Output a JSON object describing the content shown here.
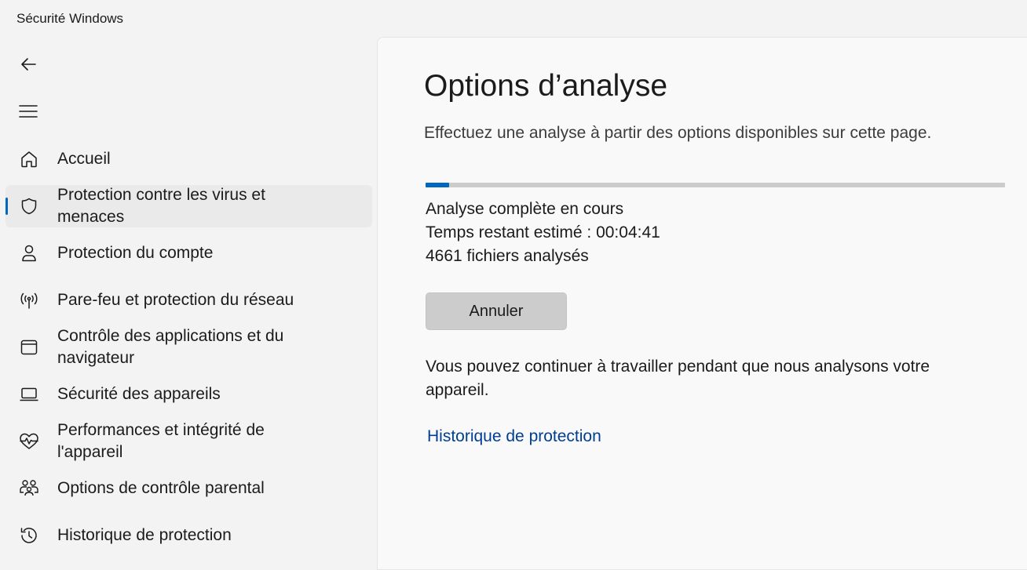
{
  "window": {
    "title": "Sécurité Windows"
  },
  "nav": {
    "back_icon": "back-arrow-icon",
    "menu_icon": "hamburger-menu-icon",
    "items": [
      {
        "label": "Accueil",
        "icon": "home-icon",
        "active": false
      },
      {
        "label": "Protection contre les virus et menaces",
        "icon": "shield-icon",
        "active": true
      },
      {
        "label": "Protection du compte",
        "icon": "person-icon",
        "active": false
      },
      {
        "label": "Pare-feu et protection du réseau",
        "icon": "wireless-antenna-icon",
        "active": false
      },
      {
        "label": "Contrôle des applications et du navigateur",
        "icon": "app-window-icon",
        "active": false
      },
      {
        "label": "Sécurité des appareils",
        "icon": "laptop-icon",
        "active": false
      },
      {
        "label": "Performances et intégrité de l'appareil",
        "icon": "heart-pulse-icon",
        "active": false
      },
      {
        "label": "Options de contrôle parental",
        "icon": "family-icon",
        "active": false
      },
      {
        "label": "Historique de protection",
        "icon": "history-icon",
        "active": false
      }
    ]
  },
  "main": {
    "title": "Options d’analyse",
    "subtitle": "Effectuez une analyse à partir des options disponibles sur cette page.",
    "scan": {
      "progress_fraction": 0.04,
      "status": "Analyse complète en cours",
      "time_remaining": "Temps restant estimé : 00:04:41",
      "files_scanned": "4661 fichiers analysés"
    },
    "cancel_label": "Annuler",
    "info": "Vous pouvez continuer à travailler pendant que nous analysons votre appareil.",
    "history_link": "Historique de protection"
  },
  "colors": {
    "accent": "#0067c0",
    "link": "#003e92",
    "progress_track": "#cccccc",
    "active_nav_bg": "#eaeaea"
  }
}
